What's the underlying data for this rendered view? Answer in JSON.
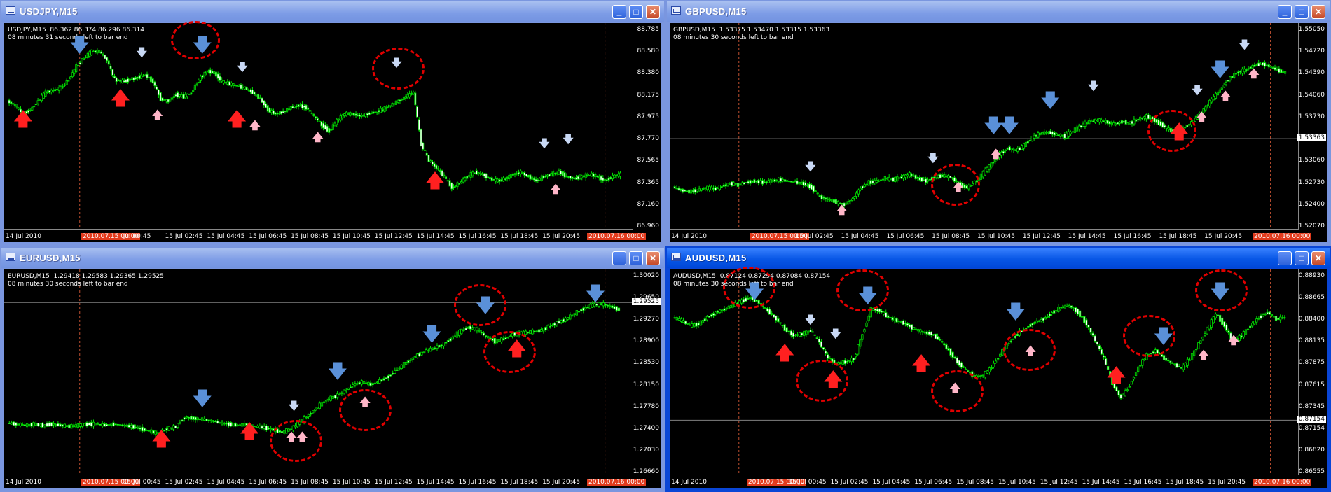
{
  "windows": [
    {
      "id": "usdjpy",
      "title": "USDJPY,M15",
      "info_line1": "USDJPY,M15  86.362 86.374 86.296 86.314",
      "info_line2": "08 minutes 31 seconds left to bar end",
      "price_ticks": [
        "88.785",
        "88.580",
        "88.380",
        "88.175",
        "87.975",
        "87.770",
        "87.565",
        "87.365",
        "87.160",
        "86.960"
      ],
      "current_price": "",
      "time_ticks": [
        "14 Jul 2010",
        "2010.07.15 00:00",
        "Jul 00:45",
        "15 Jul 02:45",
        "15 Jul 04:45",
        "15 Jul 06:45",
        "15 Jul 08:45",
        "15 Jul 10:45",
        "15 Jul 12:45",
        "15 Jul 14:45",
        "15 Jul 16:45",
        "15 Jul 18:45",
        "15 Jul 20:45",
        "2010.07.16 00:00"
      ],
      "series": [
        88.1,
        88.06,
        87.98,
        88.02,
        88.1,
        88.18,
        88.2,
        88.22,
        88.3,
        88.42,
        88.5,
        88.56,
        88.56,
        88.48,
        88.3,
        88.28,
        88.3,
        88.32,
        88.34,
        88.28,
        88.12,
        88.1,
        88.16,
        88.14,
        88.18,
        88.3,
        88.38,
        88.36,
        88.28,
        88.26,
        88.24,
        88.22,
        88.18,
        88.12,
        88.02,
        87.98,
        88.0,
        88.04,
        88.06,
        88.04,
        87.96,
        87.88,
        87.82,
        87.92,
        87.98,
        87.98,
        87.96,
        87.98,
        88.0,
        88.02,
        88.06,
        88.1,
        88.14,
        88.18,
        87.7,
        87.55,
        87.48,
        87.4,
        87.3,
        87.34,
        87.4,
        87.44,
        87.42,
        87.38,
        87.36,
        87.38,
        87.42,
        87.44,
        87.4,
        87.36,
        87.4,
        87.42,
        87.44,
        87.4,
        87.38,
        87.4,
        87.42,
        87.4,
        87.36,
        87.4,
        87.42
      ]
    },
    {
      "id": "gbpusd",
      "title": "GBPUSD,M15",
      "info_line1": "GBPUSD,M15  1.53375 1.53470 1.53315 1.53363",
      "info_line2": "08 minutes 30 seconds left to bar end",
      "price_ticks": [
        "1.55050",
        "1.54720",
        "1.54390",
        "1.54060",
        "1.53730",
        "1.53363",
        "1.53060",
        "1.52730",
        "1.52400",
        "1.52070"
      ],
      "current_price": "1.53363",
      "time_ticks": [
        "14 Jul 2010",
        "2010.07.15 00:00",
        "15 Jul 02:45",
        "15 Jul 04:45",
        "15 Jul 06:45",
        "15 Jul 08:45",
        "15 Jul 10:45",
        "15 Jul 12:45",
        "15 Jul 14:45",
        "15 Jul 16:45",
        "15 Jul 18:45",
        "15 Jul 20:45",
        "2010.07.16 00:00"
      ],
      "series": [
        1.5263,
        1.5258,
        1.5256,
        1.5258,
        1.5262,
        1.526,
        1.5264,
        1.5268,
        1.5266,
        1.527,
        1.5272,
        1.527,
        1.5272,
        1.5274,
        1.5272,
        1.527,
        1.5268,
        1.5262,
        1.5248,
        1.5244,
        1.524,
        1.5236,
        1.5245,
        1.5262,
        1.527,
        1.5272,
        1.5276,
        1.5274,
        1.5278,
        1.5282,
        1.5276,
        1.5272,
        1.5278,
        1.528,
        1.5278,
        1.5268,
        1.5262,
        1.527,
        1.5284,
        1.5298,
        1.5312,
        1.5322,
        1.5318,
        1.5326,
        1.5338,
        1.5344,
        1.5346,
        1.5342,
        1.534,
        1.5348,
        1.5356,
        1.5362,
        1.5364,
        1.5362,
        1.5358,
        1.5362,
        1.536,
        1.5366,
        1.537,
        1.5364,
        1.5356,
        1.5348,
        1.535,
        1.5356,
        1.5366,
        1.538,
        1.5396,
        1.541,
        1.5426,
        1.5436,
        1.544,
        1.5446,
        1.545,
        1.5446,
        1.544,
        1.5436
      ]
    },
    {
      "id": "eurusd",
      "title": "EURUSD,M15",
      "info_line1": "EURUSD,M15  1.29418 1.29583 1.29365 1.29525",
      "info_line2": "08 minutes 30 seconds left to bar end",
      "price_ticks": [
        "1.30020",
        "1.29650",
        "1.29270",
        "1.28900",
        "1.28530",
        "1.28150",
        "1.27780",
        "1.27400",
        "1.27030",
        "1.26660"
      ],
      "current_price": "1.29525",
      "time_ticks": [
        "14 Jul 2010",
        "2010.07.15 00:00",
        "15 Jul 00:45",
        "15 Jul 02:45",
        "15 Jul 04:45",
        "15 Jul 06:45",
        "15 Jul 08:45",
        "15 Jul 10:45",
        "15 Jul 12:45",
        "15 Jul 14:45",
        "15 Jul 16:45",
        "15 Jul 18:45",
        "15 Jul 20:45",
        "2010.07.16 00:00"
      ],
      "series": [
        1.2746,
        1.2744,
        1.2742,
        1.2744,
        1.2742,
        1.2744,
        1.2742,
        1.274,
        1.2742,
        1.2744,
        1.2744,
        1.2742,
        1.2744,
        1.2742,
        1.274,
        1.2736,
        1.2732,
        1.2728,
        1.2736,
        1.274,
        1.2756,
        1.2754,
        1.2752,
        1.275,
        1.2746,
        1.2744,
        1.2742,
        1.2744,
        1.274,
        1.2738,
        1.2734,
        1.273,
        1.2736,
        1.2748,
        1.276,
        1.2774,
        1.2786,
        1.2792,
        1.28,
        1.2812,
        1.2816,
        1.2812,
        1.2818,
        1.2826,
        1.2838,
        1.285,
        1.286,
        1.2868,
        1.2874,
        1.288,
        1.289,
        1.2902,
        1.291,
        1.2906,
        1.2894,
        1.2886,
        1.289,
        1.2898,
        1.29,
        1.2902,
        1.2904,
        1.291,
        1.2918,
        1.2924,
        1.2934,
        1.2942,
        1.2948,
        1.295,
        1.2946,
        1.294
      ]
    },
    {
      "id": "audusd",
      "title": "AUDUSD,M15",
      "info_line1": "AUDUSD,M15  0.87124 0.87294 0.87084 0.87154",
      "info_line2": "08 minutes 30 seconds left to bar end",
      "price_ticks": [
        "0.88930",
        "0.88665",
        "0.88400",
        "0.88135",
        "0.87875",
        "0.87615",
        "0.87345",
        "0.87154",
        "0.86820",
        "0.86555"
      ],
      "current_price": "0.87154",
      "time_ticks": [
        "14 Jul 2010",
        "2010.07.15 00:00",
        "15 Jul 00:45",
        "15 Jul 02:45",
        "15 Jul 04:45",
        "15 Jul 06:45",
        "15 Jul 08:45",
        "15 Jul 10:45",
        "15 Jul 12:45",
        "15 Jul 14:45",
        "15 Jul 16:45",
        "15 Jul 18:45",
        "15 Jul 20:45",
        "2010.07.16 00:00"
      ],
      "series": [
        0.884,
        0.8836,
        0.883,
        0.8832,
        0.884,
        0.8846,
        0.885,
        0.8855,
        0.886,
        0.8864,
        0.8858,
        0.8848,
        0.8838,
        0.8826,
        0.8818,
        0.882,
        0.8824,
        0.881,
        0.879,
        0.8784,
        0.8786,
        0.879,
        0.882,
        0.885,
        0.8848,
        0.884,
        0.8836,
        0.8832,
        0.8826,
        0.8822,
        0.882,
        0.8812,
        0.88,
        0.8786,
        0.8776,
        0.8768,
        0.877,
        0.878,
        0.8796,
        0.881,
        0.882,
        0.8828,
        0.8834,
        0.8838,
        0.8846,
        0.8852,
        0.8854,
        0.8846,
        0.8832,
        0.8812,
        0.879,
        0.876,
        0.8742,
        0.8758,
        0.878,
        0.8794,
        0.88,
        0.879,
        0.8784,
        0.8778,
        0.879,
        0.8808,
        0.8826,
        0.8844,
        0.883,
        0.881,
        0.8818,
        0.883,
        0.884,
        0.8846,
        0.8838,
        0.884
      ]
    }
  ],
  "colors": {
    "candle": "#00e000",
    "candle_bull_body": "#000000",
    "candle_bear_body": "#ffffff",
    "buy_arrow": "#ff2020",
    "buy_arrow_small": "#ffb6c8",
    "sell_arrow": "#5a90d8",
    "sell_arrow_small": "#c8d8f4",
    "circle": "#e00000",
    "grid_line": "#808080",
    "period_sep": "#c05030"
  },
  "icons": {
    "window_icon": "chart-window-icon",
    "minimize": "minimize-icon",
    "maximize": "maximize-icon",
    "close": "close-icon",
    "buy_arrow": "up-arrow-icon",
    "sell_arrow": "down-arrow-icon"
  },
  "buttons": {
    "minimize": "_",
    "maximize": "□",
    "close": "✕"
  },
  "arrows": {
    "up": "🡅",
    "down": "🡇"
  },
  "active_window": "audusd"
}
